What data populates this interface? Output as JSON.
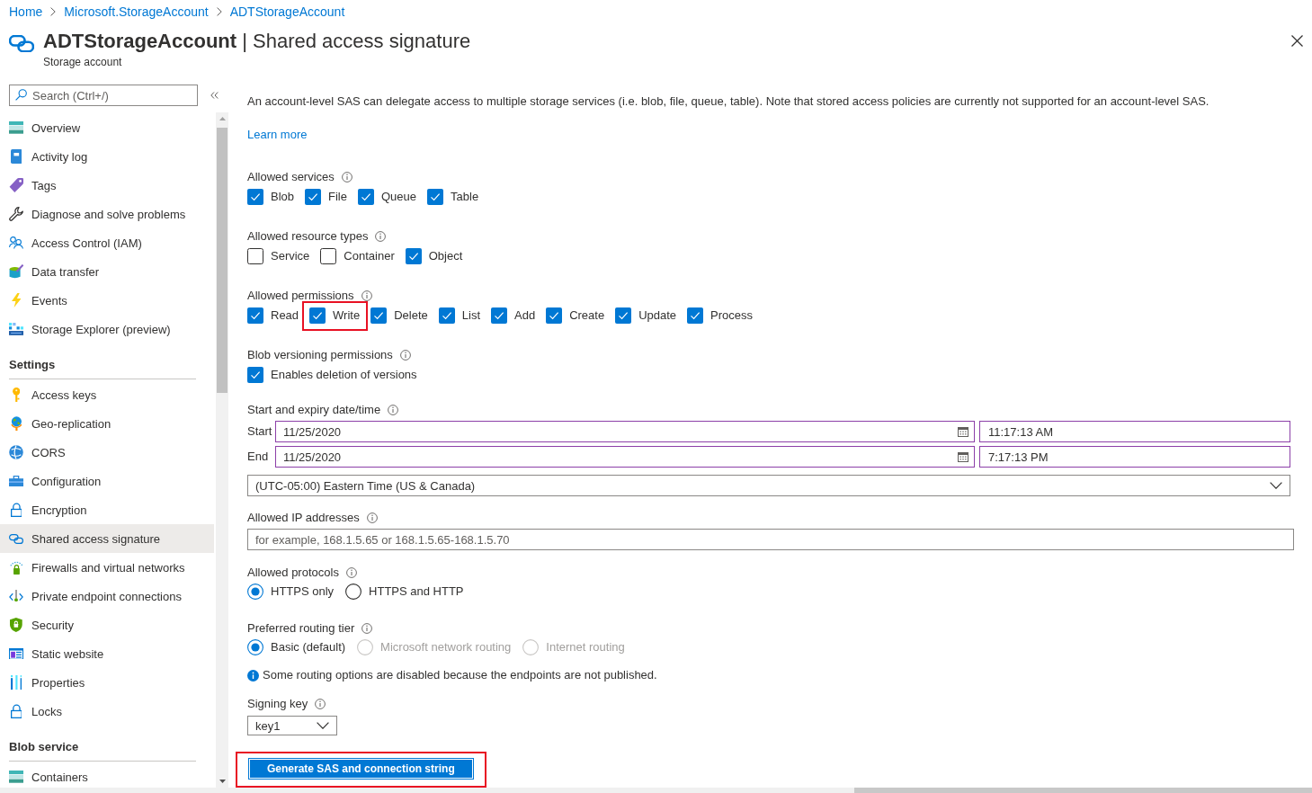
{
  "breadcrumb": [
    {
      "label": "Home"
    },
    {
      "label": "Microsoft.StorageAccount"
    },
    {
      "label": "ADTStorageAccount"
    }
  ],
  "header": {
    "title": "**ADTStorageAccount** | Shared access signature",
    "subtitle": "Storage account"
  },
  "sidebar": {
    "search": {
      "placeholder": "Search (Ctrl+/)"
    },
    "groups": [
      {
        "items": [
          {
            "label": "Overview",
            "selected": false
          },
          {
            "label": "Activity log",
            "selected": false
          },
          {
            "label": "Tags",
            "selected": false
          },
          {
            "label": "Diagnose and solve problems",
            "selected": false
          },
          {
            "label": "Access Control (IAM)",
            "selected": false
          },
          {
            "label": "Data transfer",
            "selected": false
          },
          {
            "label": "Events",
            "selected": false
          },
          {
            "label": "Storage Explorer (preview)",
            "selected": false
          }
        ]
      },
      {
        "heading": "Settings",
        "items": [
          {
            "label": "Access keys",
            "selected": false
          },
          {
            "label": "Geo-replication",
            "selected": false
          },
          {
            "label": "CORS",
            "selected": false
          },
          {
            "label": "Configuration",
            "selected": false
          },
          {
            "label": "Encryption",
            "selected": false
          },
          {
            "label": "Shared access signature",
            "selected": true
          },
          {
            "label": "Firewalls and virtual networks",
            "selected": false
          },
          {
            "label": "Private endpoint connections",
            "selected": false
          },
          {
            "label": "Security",
            "selected": false
          },
          {
            "label": "Static website",
            "selected": false
          },
          {
            "label": "Properties",
            "selected": false
          },
          {
            "label": "Locks",
            "selected": false
          }
        ]
      },
      {
        "heading": "Blob service",
        "items": [
          {
            "label": "Containers",
            "selected": false
          }
        ]
      }
    ]
  },
  "content": {
    "description": "An account-level SAS can delegate access to multiple storage services (i.e. blob, file, queue, table). Note that stored access policies are currently not supported for an account-level SAS.",
    "learn_more": "Learn more",
    "allowed_services": {
      "label": "Allowed services",
      "options": [
        {
          "label": "Blob",
          "checked": true
        },
        {
          "label": "File",
          "checked": true
        },
        {
          "label": "Queue",
          "checked": true
        },
        {
          "label": "Table",
          "checked": true
        }
      ]
    },
    "allowed_resource_types": {
      "label": "Allowed resource types",
      "options": [
        {
          "label": "Service",
          "checked": false
        },
        {
          "label": "Container",
          "checked": false
        },
        {
          "label": "Object",
          "checked": true
        }
      ]
    },
    "allowed_permissions": {
      "label": "Allowed permissions",
      "options": [
        {
          "label": "Read",
          "checked": true,
          "highlighted": false
        },
        {
          "label": "Write",
          "checked": true,
          "highlighted": true
        },
        {
          "label": "Delete",
          "checked": true,
          "highlighted": false
        },
        {
          "label": "List",
          "checked": true,
          "highlighted": false
        },
        {
          "label": "Add",
          "checked": true,
          "highlighted": false
        },
        {
          "label": "Create",
          "checked": true,
          "highlighted": false
        },
        {
          "label": "Update",
          "checked": true,
          "highlighted": false
        },
        {
          "label": "Process",
          "checked": true,
          "highlighted": false
        }
      ]
    },
    "blob_versioning_permissions": {
      "label": "Blob versioning permissions",
      "options": [
        {
          "label": "Enables deletion of versions",
          "checked": true
        }
      ]
    },
    "start_expiry": {
      "label": "Start and expiry date/time",
      "rows": [
        {
          "label": "Start",
          "date": "11/25/2020",
          "time": "11:17:13 AM"
        },
        {
          "label": "End",
          "date": "11/25/2020",
          "time": "7:17:13 PM"
        }
      ],
      "time_zone": "(UTC-05:00) Eastern Time (US & Canada)"
    },
    "allowed_ip_addresses": {
      "label": "Allowed IP addresses",
      "placeholder": "for example, 168.1.5.65 or 168.1.5.65-168.1.5.70"
    },
    "allowed_protocols": {
      "label": "Allowed protocols",
      "options": [
        {
          "label": "HTTPS only",
          "selected": true,
          "disabled": false
        },
        {
          "label": "HTTPS and HTTP",
          "selected": false,
          "disabled": false
        }
      ]
    },
    "preferred_routing_tier": {
      "label": "Preferred routing tier",
      "options": [
        {
          "label": "Basic (default)",
          "selected": true,
          "disabled": false
        },
        {
          "label": "Microsoft network routing",
          "selected": false,
          "disabled": true
        },
        {
          "label": "Internet routing",
          "selected": false,
          "disabled": true
        }
      ]
    },
    "routing_note": "Some routing options are disabled because the endpoints are not published.",
    "signing_key": {
      "label": "Signing key",
      "value": "key1"
    },
    "generate_button": {
      "label": "Generate SAS and connection string",
      "highlighted": true
    }
  }
}
